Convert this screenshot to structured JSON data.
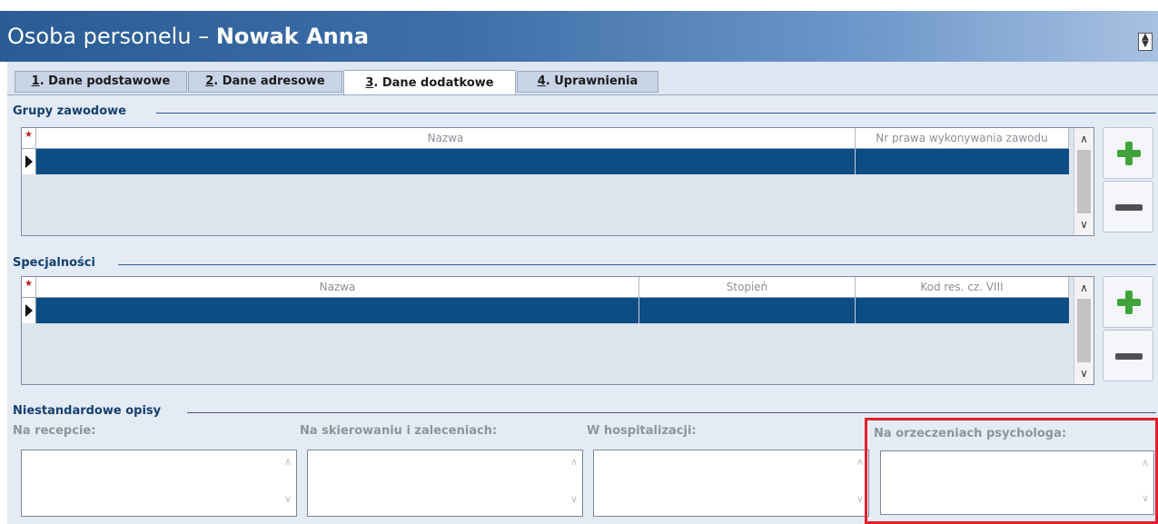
{
  "window": {
    "title_prefix": "Osoba personelu – ",
    "title_name": "Nowak Anna"
  },
  "tabs": [
    {
      "num": "1",
      "label": ". Dane podstawowe"
    },
    {
      "num": "2",
      "label": ". Dane adresowe"
    },
    {
      "num": "3",
      "label": ". Dane dodatkowe",
      "active": true
    },
    {
      "num": "4",
      "label": ". Uprawnienia"
    }
  ],
  "grupy": {
    "title": "Grupy zawodowe",
    "columns": [
      "Nazwa",
      "Nr prawa wykonywania zawodu"
    ],
    "star": "★"
  },
  "specjalnosci": {
    "title": "Specjalności",
    "columns": [
      "Nazwa",
      "Stopień",
      "Kod res. cz. VIII"
    ],
    "star": "★"
  },
  "opisy": {
    "title": "Niestandardowe opisy",
    "fields": [
      "Na recepcie:",
      "Na skierowaniu i zaleceniach:",
      "W hospitalizacji:",
      "Na orzeczeniach psychologa:"
    ]
  },
  "icons": {
    "add": "plus-icon",
    "remove": "minus-icon"
  },
  "colors": {
    "selected_row": "#0d4c84",
    "section": "#14406f",
    "highlight": "#e0202c",
    "add_icon": "#3fa33a"
  }
}
